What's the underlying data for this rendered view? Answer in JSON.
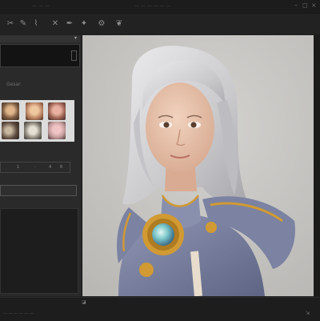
{
  "titlebar": {
    "app_name": "— — —",
    "document": "— — — — — —",
    "controls": [
      "–",
      "◻",
      "×"
    ]
  },
  "toolbar": {
    "tools": [
      {
        "name": "scissors-icon",
        "glyph": "✂"
      },
      {
        "name": "pen-icon",
        "glyph": "✎"
      },
      {
        "name": "zigzag-icon",
        "glyph": "⌇"
      },
      {
        "name": "transform-icon",
        "glyph": "✕"
      },
      {
        "name": "ink-icon",
        "glyph": "✒"
      },
      {
        "name": "wand-icon",
        "glyph": "✦"
      },
      {
        "name": "settings-icon",
        "glyph": "⚙"
      },
      {
        "name": "leaf-icon",
        "glyph": "❦"
      }
    ]
  },
  "sidebar": {
    "panel_icon": "▾",
    "section_label": "Gesar",
    "values_row": [
      "1",
      "·",
      "4",
      "6"
    ],
    "thumbnails": [
      {
        "name": "thumbnail-1",
        "color": "#7a5a40"
      },
      {
        "name": "thumbnail-2",
        "color": "#b88060"
      },
      {
        "name": "thumbnail-3",
        "color": "#9a6050"
      },
      {
        "name": "thumbnail-4",
        "color": "#5d4a3e"
      },
      {
        "name": "thumbnail-5",
        "color": "#8a8578"
      },
      {
        "name": "thumbnail-6",
        "color": "#c49a9a"
      }
    ]
  },
  "canvas": {
    "subject": "portrait-image",
    "background_color": "#c9c8c5",
    "colors": {
      "hair": "#d6d6d8",
      "skin": "#e8c4ad",
      "armor": "#7b82a2",
      "gold": "#d19a33",
      "gem": "#7cc7c9"
    }
  },
  "statusbar": {
    "text": "— — — — — —",
    "left_icon": "◪",
    "right_icon": "⇲"
  }
}
